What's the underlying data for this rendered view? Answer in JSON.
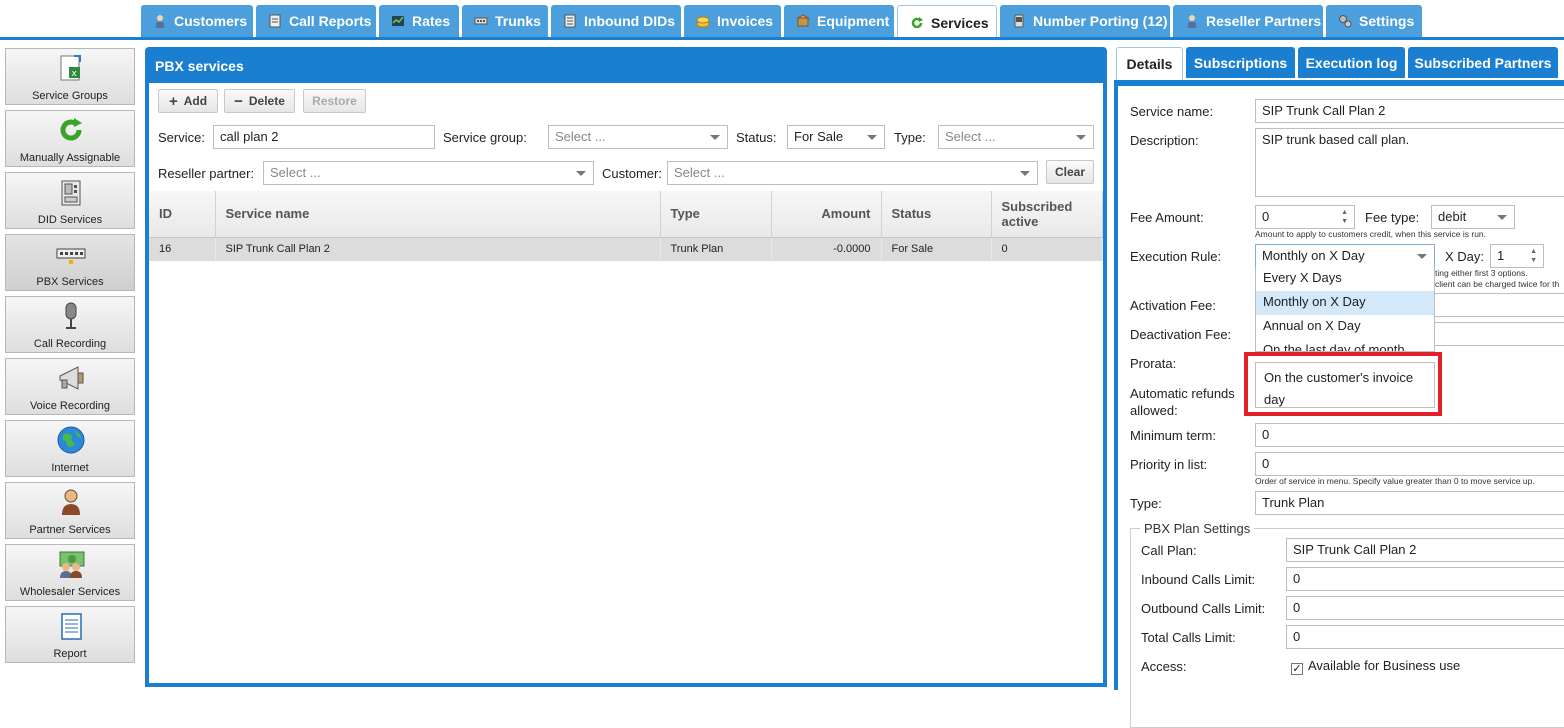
{
  "top_tabs": [
    {
      "label": "Customers",
      "icon": "person-icon"
    },
    {
      "label": "Call Reports",
      "icon": "report-icon"
    },
    {
      "label": "Rates",
      "icon": "chart-icon"
    },
    {
      "label": "Trunks",
      "icon": "trunk-icon"
    },
    {
      "label": "Inbound DIDs",
      "icon": "document-icon"
    },
    {
      "label": "Invoices",
      "icon": "coins-icon"
    },
    {
      "label": "Equipment",
      "icon": "box-icon"
    },
    {
      "label": "Services",
      "icon": "refresh-icon",
      "active": true
    },
    {
      "label": "Number Porting (12)",
      "icon": "phone-icon"
    },
    {
      "label": "Reseller Partners",
      "icon": "person-icon"
    },
    {
      "label": "Settings",
      "icon": "gears-icon"
    }
  ],
  "sidebar": [
    {
      "label": "Service Groups",
      "icon": "spreadsheet-icon"
    },
    {
      "label": "Manually Assignable",
      "icon": "refresh-icon"
    },
    {
      "label": "DID Services",
      "icon": "fax-icon"
    },
    {
      "label": "PBX Services",
      "icon": "switch-icon",
      "active": true
    },
    {
      "label": "Call Recording",
      "icon": "microphone-icon"
    },
    {
      "label": "Voice Recording",
      "icon": "megaphone-icon"
    },
    {
      "label": "Internet",
      "icon": "globe-icon"
    },
    {
      "label": "Partner Services",
      "icon": "person-icon"
    },
    {
      "label": "Wholesaler Services",
      "icon": "money-people-icon"
    },
    {
      "label": "Report",
      "icon": "notebook-icon"
    }
  ],
  "pbx": {
    "title": "PBX services",
    "toolbar": {
      "add": "Add",
      "delete": "Delete",
      "restore": "Restore"
    },
    "filters": {
      "service_label": "Service:",
      "service_value": "call plan 2",
      "group_label": "Service group:",
      "group_placeholder": "Select ...",
      "status_label": "Status:",
      "status_value": "For Sale",
      "type_label": "Type:",
      "type_placeholder": "Select ...",
      "reseller_label": "Reseller partner:",
      "reseller_placeholder": "Select ...",
      "customer_label": "Customer:",
      "customer_placeholder": "Select ...",
      "clear": "Clear"
    },
    "columns": [
      "ID",
      "Service name",
      "Type",
      "Amount",
      "Status",
      "Subscribed active"
    ],
    "rows": [
      {
        "id": "16",
        "name": "SIP Trunk Call Plan 2",
        "type": "Trunk Plan",
        "amount": "-0.0000",
        "status": "For Sale",
        "subscribed": "0"
      }
    ]
  },
  "right_tabs": [
    "Details",
    "Subscriptions",
    "Execution log",
    "Subscribed Partners"
  ],
  "details": {
    "service_name_label": "Service name:",
    "service_name": "SIP Trunk Call Plan 2",
    "description_label": "Description:",
    "description": "SIP trunk based call plan.",
    "fee_amount_label": "Fee Amount:",
    "fee_amount": "0",
    "fee_amount_hint": "Amount to apply to customers credit, when this service is run.",
    "fee_type_label": "Fee type:",
    "fee_type": "debit",
    "execution_rule_label": "Execution Rule:",
    "execution_rule": "Monthly on X Day",
    "x_day_label": "X Day:",
    "x_day": "1",
    "x_day_hint1": "ting either first 3 options.",
    "x_day_hint2": "client can be charged twice for th",
    "dropdown_options": [
      "Every X Days",
      "Monthly on X Day",
      "Annual on X Day",
      "On the last day of month",
      "On the customer's invoice day"
    ],
    "activation_fee_label": "Activation Fee:",
    "deactivation_fee_label": "Deactivation Fee:",
    "prorata_label": "Prorata:",
    "auto_refunds_label": "Automatic refunds allowed:",
    "minimum_term_label": "Minimum term:",
    "minimum_term": "0",
    "priority_label": "Priority in list:",
    "priority": "0",
    "priority_hint": "Order of service in menu. Specify value greater than 0 to move service up.",
    "type_label": "Type:",
    "type": "Trunk Plan",
    "pbx_settings_legend": "PBX Plan Settings",
    "call_plan_label": "Call Plan:",
    "call_plan": "SIP Trunk Call Plan 2",
    "inbound_limit_label": "Inbound Calls Limit:",
    "inbound_limit": "0",
    "outbound_limit_label": "Outbound Calls Limit:",
    "outbound_limit": "0",
    "total_limit_label": "Total Calls Limit:",
    "total_limit": "0",
    "access_label": "Access:",
    "access_option": "Available for Business use"
  },
  "colors": {
    "accent": "#1a7fd0",
    "tab": "#4a9fdc",
    "highlight_box": "#e0202a",
    "selected_option": "#d3e8f8"
  }
}
